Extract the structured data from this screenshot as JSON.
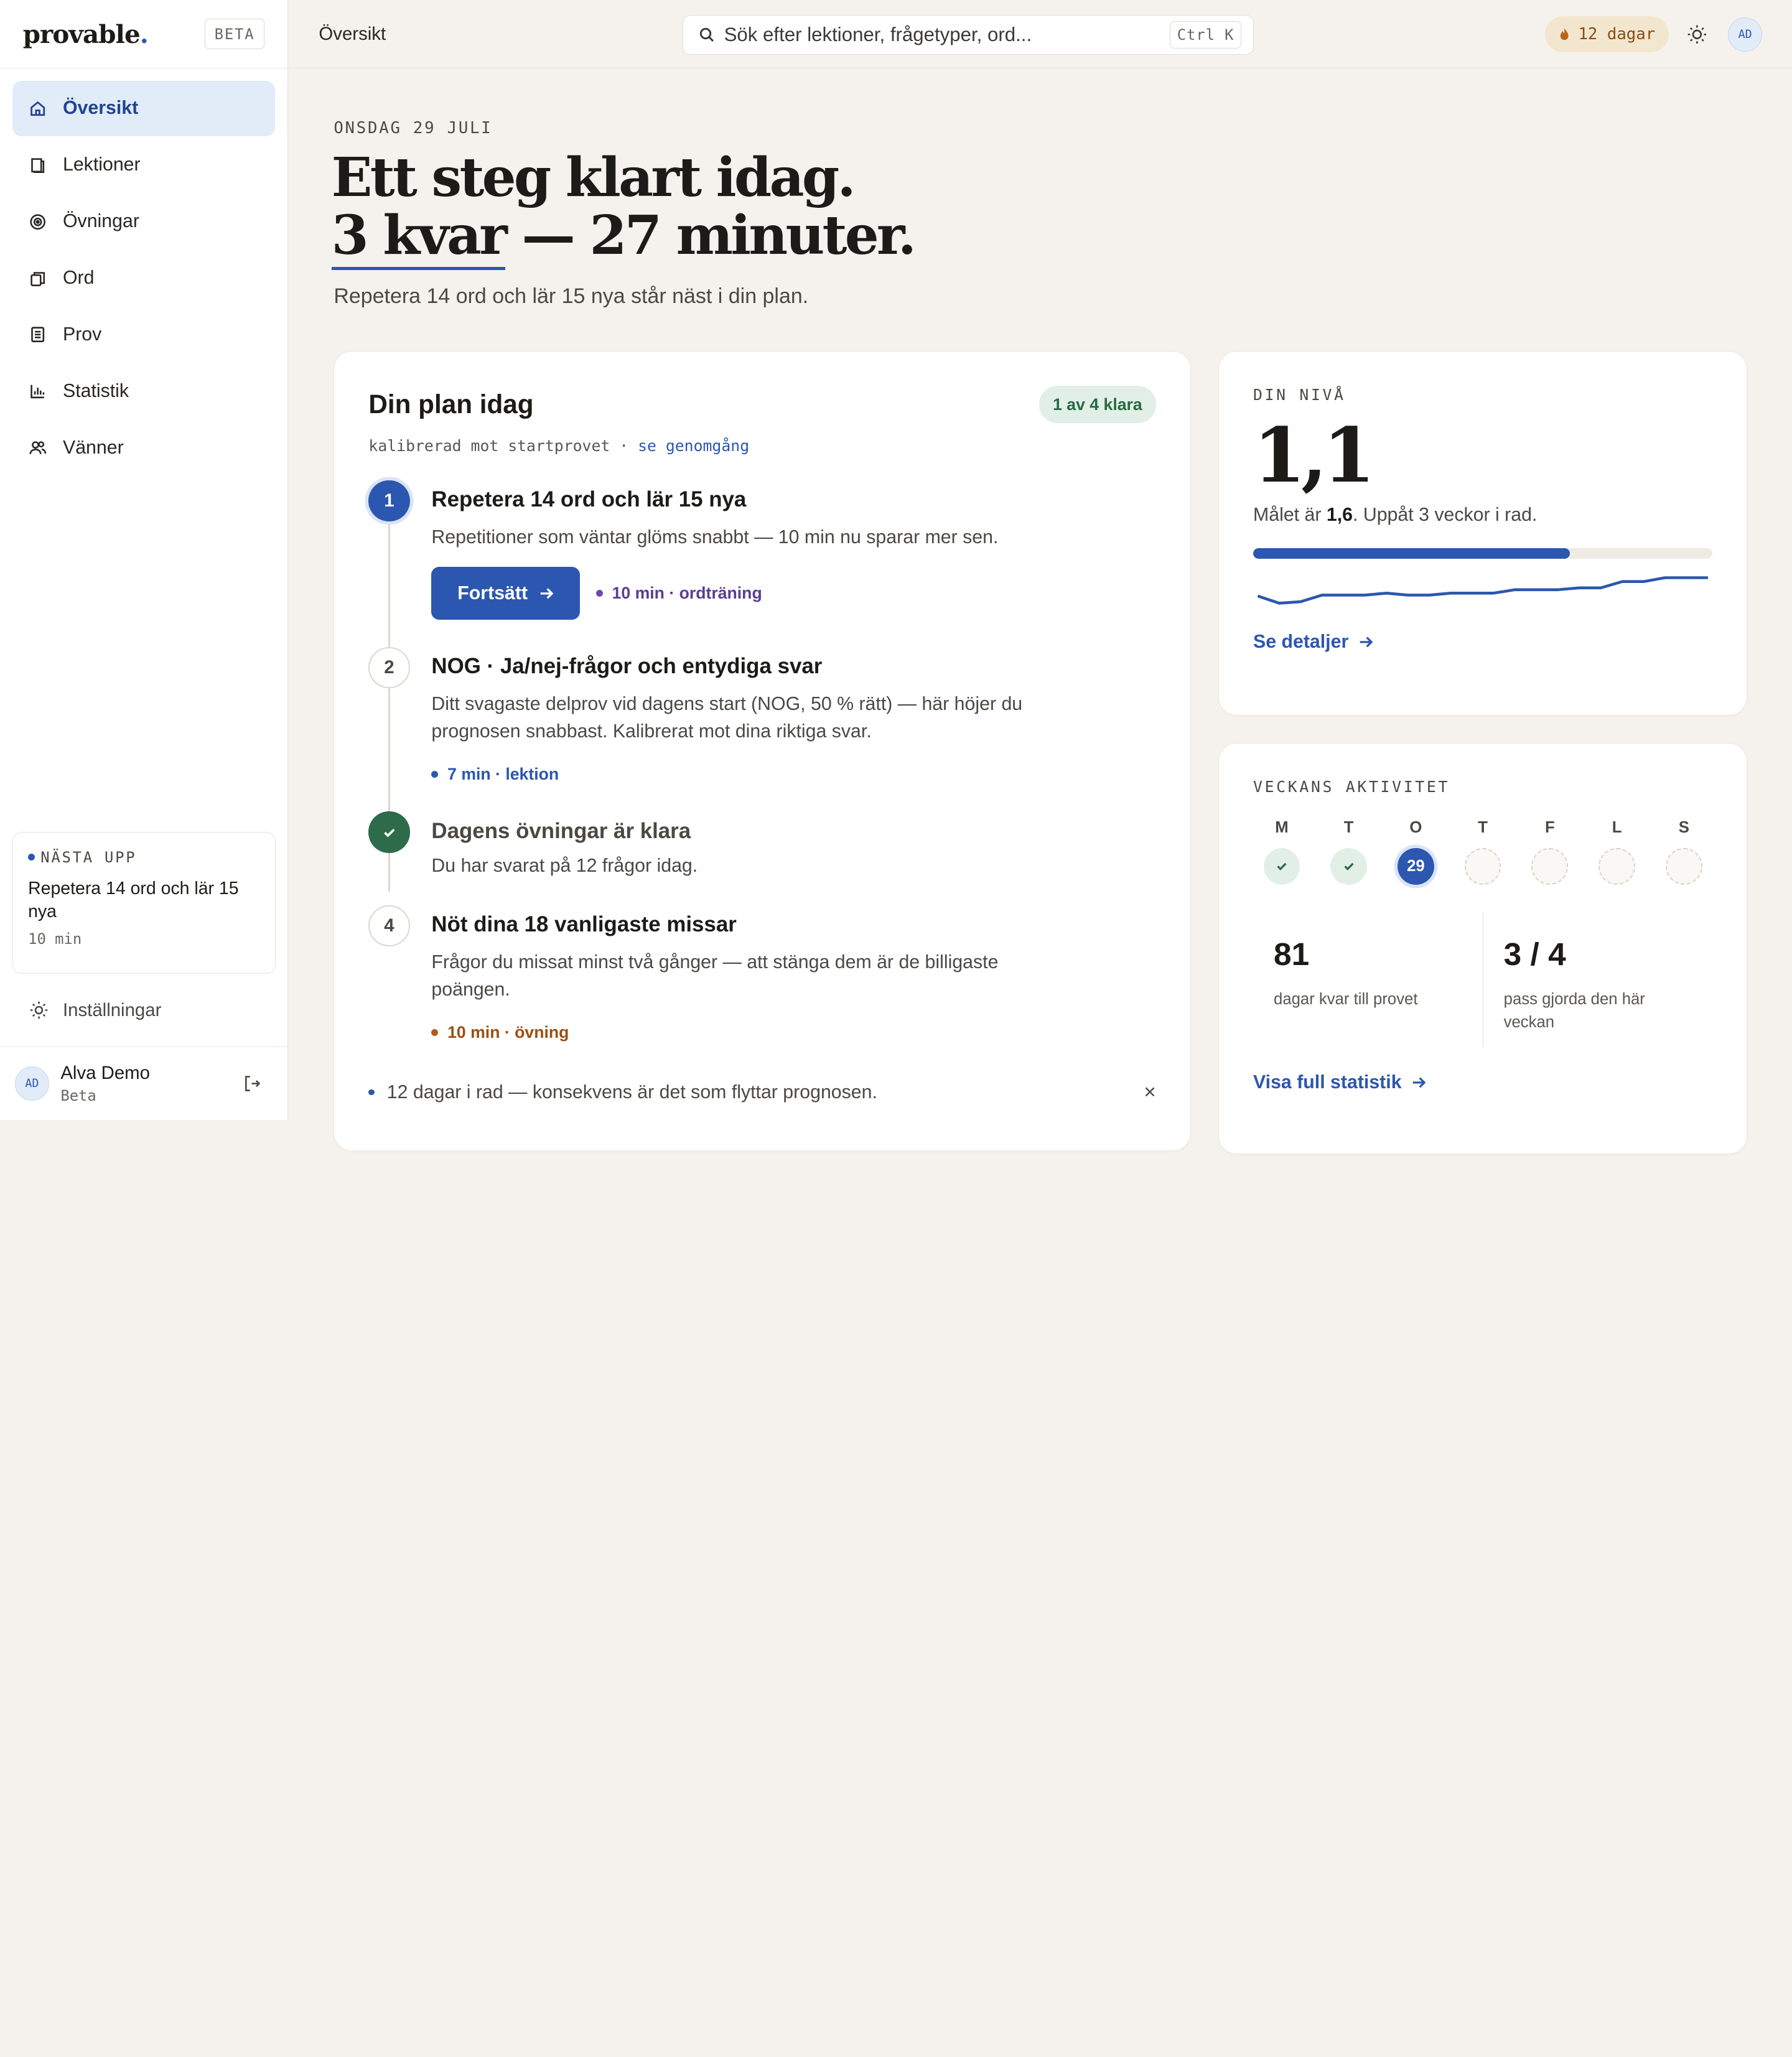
{
  "app": {
    "brand": "provable",
    "brand_dot": ".",
    "beta_tag": "BETA"
  },
  "sidebar": {
    "items": [
      {
        "label": "Översikt",
        "icon": "home-icon"
      },
      {
        "label": "Lektioner",
        "icon": "book-icon"
      },
      {
        "label": "Övningar",
        "icon": "target-icon"
      },
      {
        "label": "Ord",
        "icon": "cards-icon"
      },
      {
        "label": "Prov",
        "icon": "document-icon"
      },
      {
        "label": "Statistik",
        "icon": "bar-chart-icon"
      },
      {
        "label": "Vänner",
        "icon": "users-icon"
      }
    ],
    "next_up": {
      "label": "NÄSTA UPP",
      "title": "Repetera 14 ord och lär 15 nya",
      "duration": "10 min"
    },
    "settings_label": "Inställningar",
    "user": {
      "initials": "AD",
      "name": "Alva Demo",
      "plan": "Beta"
    }
  },
  "topbar": {
    "breadcrumb": "Översikt",
    "search_placeholder": "Sök efter lektioner, frågetyper, ord...",
    "search_shortcut": "Ctrl K",
    "streak": "12 dagar",
    "avatar_initials": "AD"
  },
  "hero": {
    "date": "ONSDAG 29 JULI",
    "line1": "Ett steg klart idag.",
    "line2_underlined": "3 kvar",
    "line2_rest": " — 27 minuter.",
    "lead": "Repetera 14 ord och lär 15 nya står näst i din plan."
  },
  "plan": {
    "title": "Din plan idag",
    "badge": "1 av 4 klara",
    "subtitle": "kalibrerad mot startprovet · ",
    "subtitle_link": "se genomgång",
    "steps": [
      {
        "marker": "1",
        "title": "Repetera 14 ord och lär 15 nya",
        "desc": "Repetitioner som väntar glöms snabbt — 10 min nu sparar mer sen.",
        "button": "Fortsätt",
        "meta": "10 min · ordträning"
      },
      {
        "marker": "2",
        "title": "NOG · Ja/nej-frågor och entydiga svar",
        "desc": "Ditt svagaste delprov vid dagens start (NOG, 50 % rätt) — här höjer du prognosen snabbast. Kalibrerat mot dina riktiga svar.",
        "meta": "7 min · lektion"
      },
      {
        "marker": "check",
        "title": "Dagens övningar är klara",
        "desc": "Du har svarat på 12 frågor idag."
      },
      {
        "marker": "4",
        "title": "Nöt dina 18 vanligaste missar",
        "desc": "Frågor du missat minst två gånger — att stänga dem är de billigaste poängen.",
        "meta": "10 min · övning"
      }
    ],
    "tip": "12 dagar i rad — konsekvens är det som flyttar prognosen.",
    "tip_close": "×"
  },
  "level": {
    "label": "DIN NIVÅ",
    "value": "1,1",
    "goal_prefix": "Målet är ",
    "goal_value": "1,6",
    "goal_suffix": ". Uppåt 3 veckor i rad.",
    "progress_fraction": 0.69,
    "trend": [
      0.6,
      0.45,
      0.48,
      0.62,
      0.62,
      0.62,
      0.66,
      0.62,
      0.62,
      0.66,
      0.66,
      0.66,
      0.73,
      0.73,
      0.73,
      0.77,
      0.77,
      0.9,
      0.9,
      0.98,
      0.98,
      0.98
    ],
    "link": "Se detaljer"
  },
  "week": {
    "label": "VECKANS AKTIVITET",
    "days": [
      {
        "letter": "M",
        "state": "done",
        "text": ""
      },
      {
        "letter": "T",
        "state": "done",
        "text": ""
      },
      {
        "letter": "O",
        "state": "today",
        "text": "29"
      },
      {
        "letter": "T",
        "state": "empty",
        "text": ""
      },
      {
        "letter": "F",
        "state": "empty",
        "text": ""
      },
      {
        "letter": "L",
        "state": "empty",
        "text": ""
      },
      {
        "letter": "S",
        "state": "empty",
        "text": ""
      }
    ],
    "stats": [
      {
        "value": "81",
        "label": "dagar kvar till provet"
      },
      {
        "value": "3 / 4",
        "label": "pass gjorda den här veckan"
      }
    ],
    "link": "Visa full statistik"
  },
  "colors": {
    "accent": "#2c57b0",
    "success": "#2e6b4a",
    "streak": "#8a4d10",
    "background": "#f5f2ed"
  }
}
